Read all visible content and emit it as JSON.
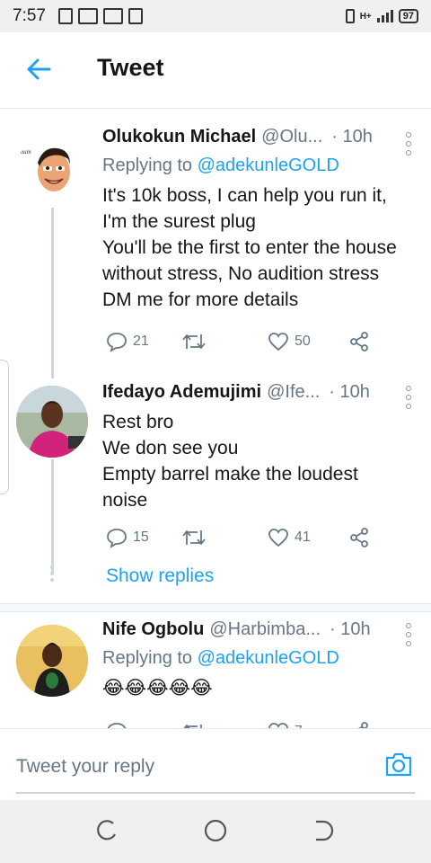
{
  "status_bar": {
    "time": "7:57",
    "network": "H+",
    "battery": "97"
  },
  "header": {
    "title": "Tweet"
  },
  "tweets": [
    {
      "name": "Olukokun Michael",
      "handle": "@Olu...",
      "time": "· 10h",
      "replying_prefix": "Replying to",
      "replying_to": "@adekunleGOLD",
      "text_lines": [
        "It's 10k boss, I can help you run it,",
        "I'm the surest plug",
        "You'll be the first to enter the house",
        "without stress, No audition stress",
        "DM me for more details"
      ],
      "replies": "21",
      "retweets": "",
      "likes": "50"
    },
    {
      "name": "Ifedayo Ademujimi",
      "handle": "@Ife...",
      "time": "· 10h",
      "text_lines": [
        "Rest bro",
        "We don see you",
        "Empty barrel make the loudest",
        "noise"
      ],
      "replies": "15",
      "retweets": "",
      "likes": "41",
      "show_replies": "Show replies"
    },
    {
      "name": "Nife Ogbolu",
      "handle": "@Harbimba...",
      "time": "· 10h",
      "replying_prefix": "Replying to",
      "replying_to": "@adekunleGOLD",
      "text_lines": [
        "😂😂😂😂😂"
      ],
      "replies": "",
      "retweets": "",
      "likes": "7"
    }
  ],
  "reply_bar": {
    "placeholder": "Tweet your reply"
  },
  "colors": {
    "accent": "#1da1f2",
    "muted": "#657786",
    "text": "#14171a"
  },
  "icons": [
    "back-arrow-icon",
    "more-icon",
    "reply-icon",
    "retweet-icon",
    "like-icon",
    "share-icon",
    "camera-icon",
    "recents-icon",
    "home-icon",
    "back-nav-icon"
  ]
}
